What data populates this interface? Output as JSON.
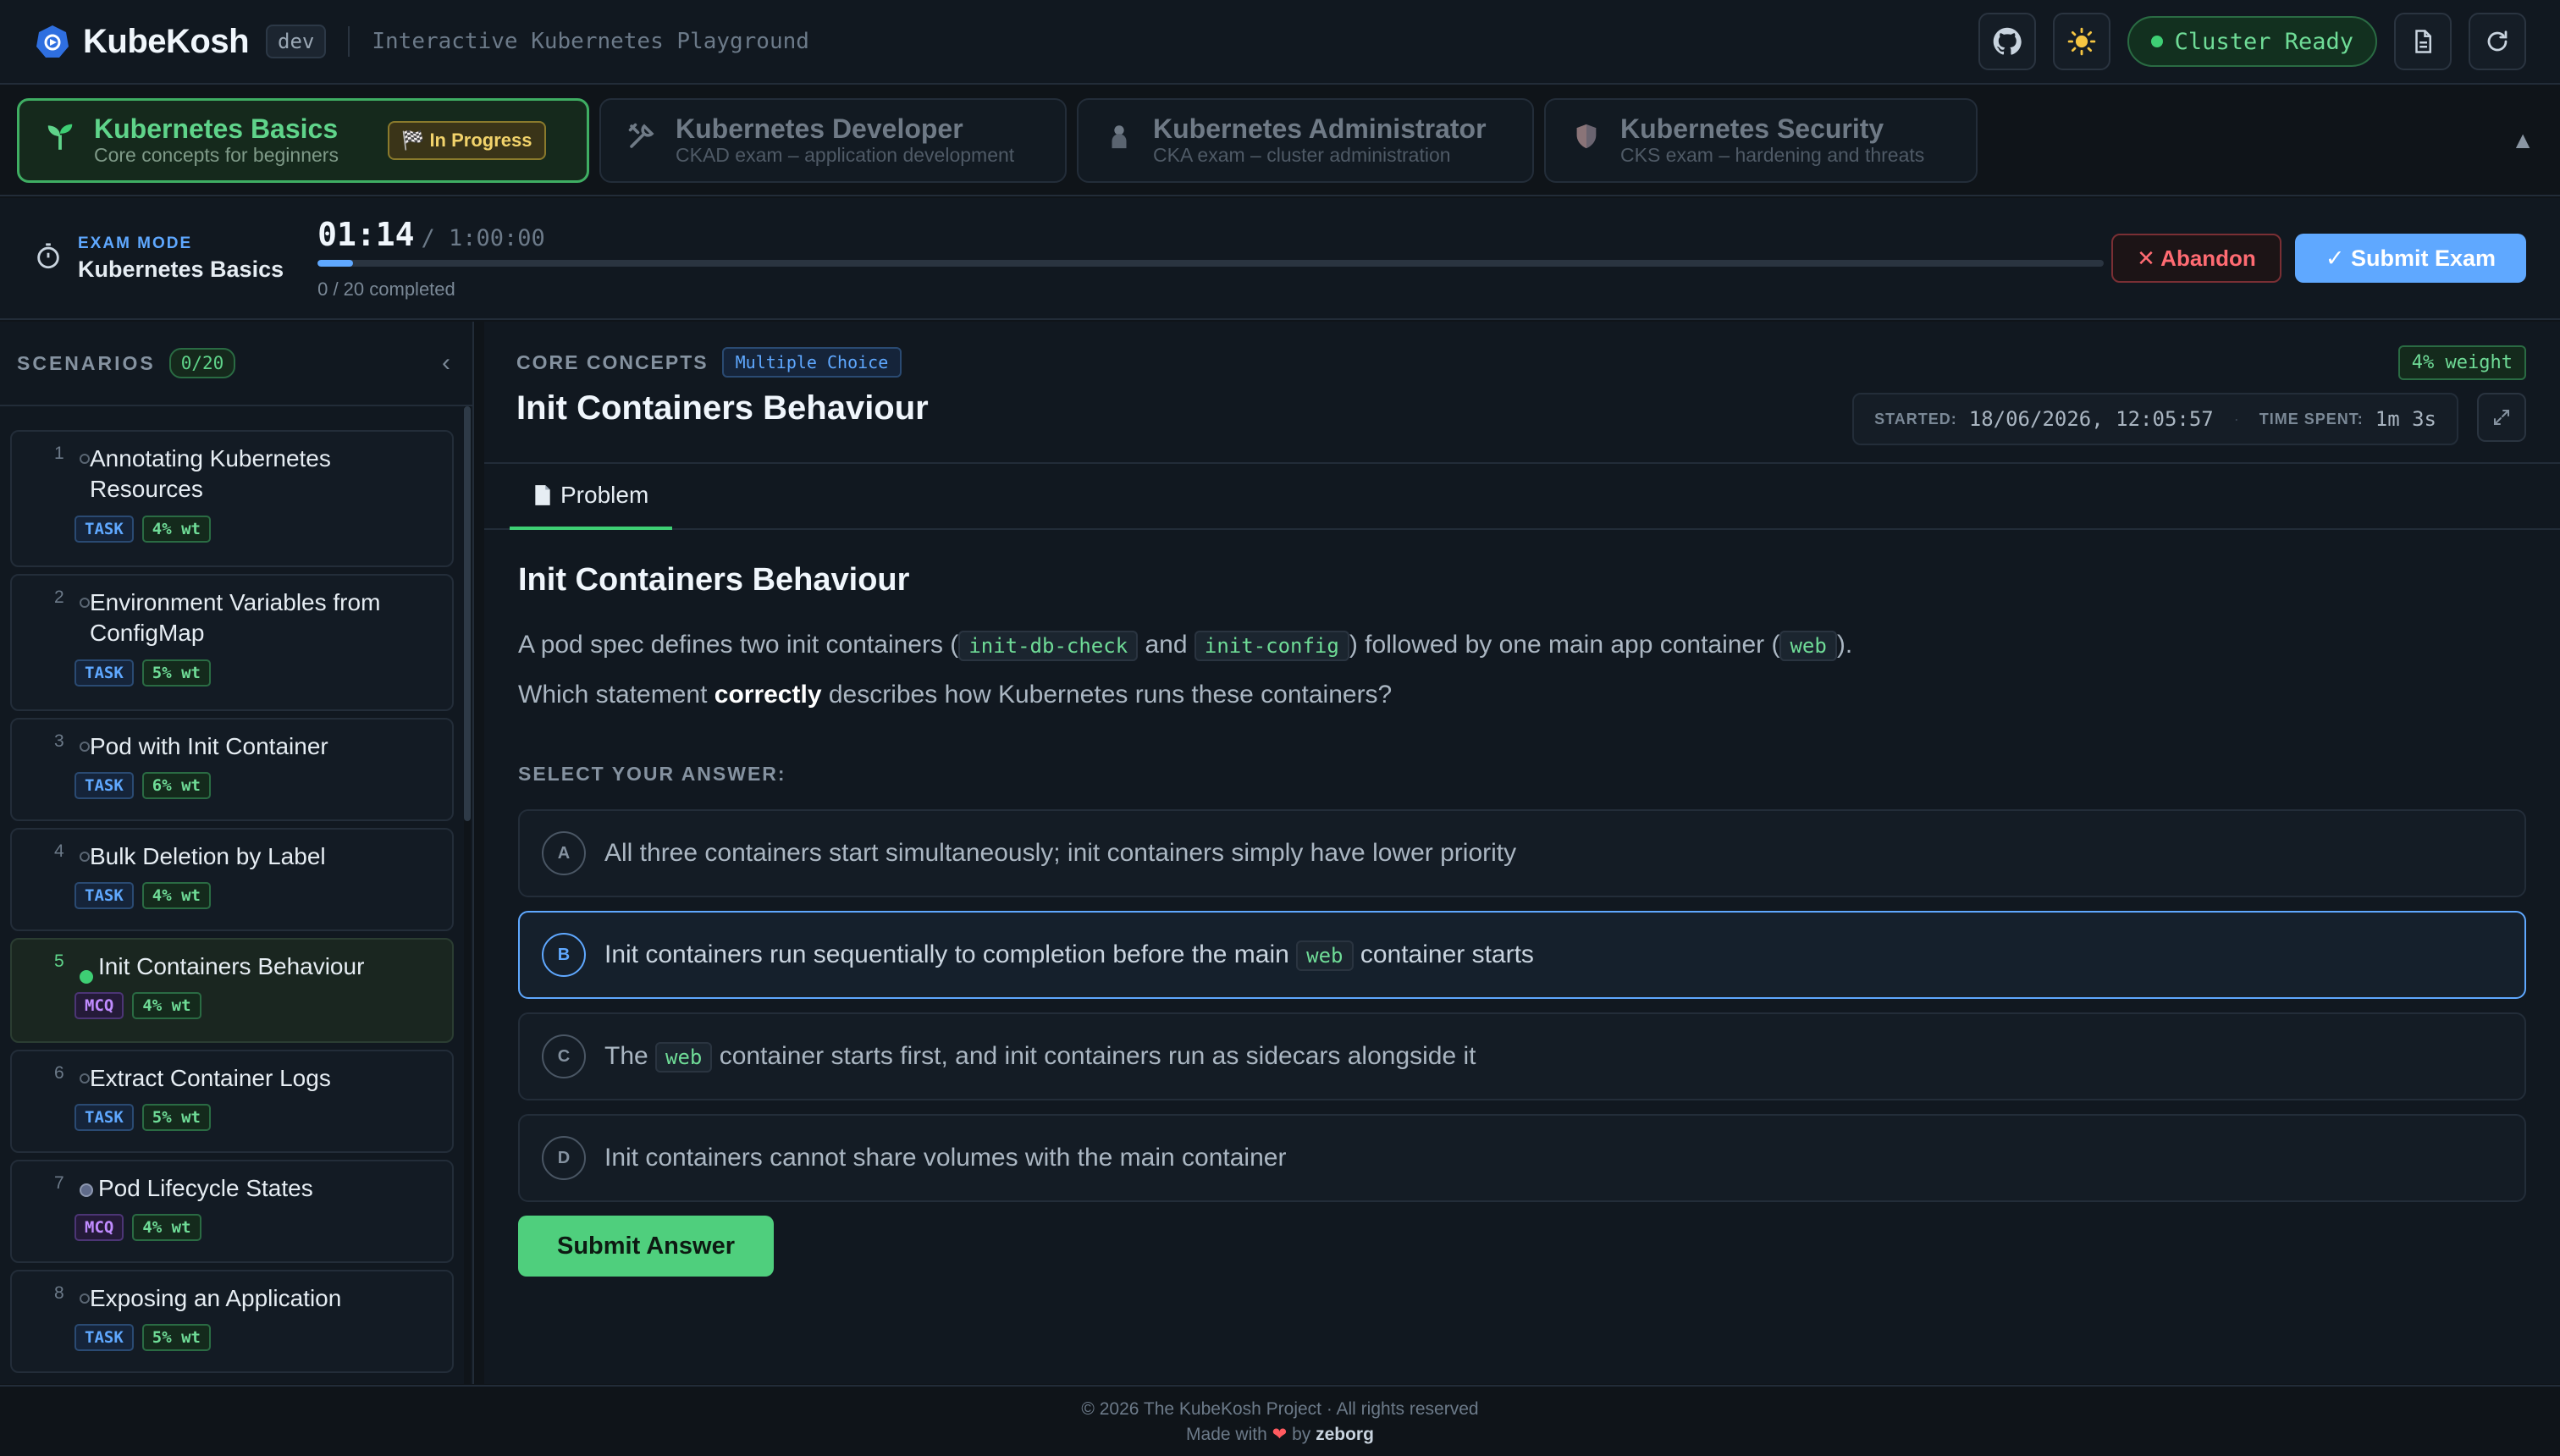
{
  "header": {
    "app_name": "KubeKosh",
    "env": "dev",
    "tagline": "Interactive Kubernetes Playground",
    "cluster_status": "Cluster Ready",
    "icons": [
      "github-icon",
      "sun-icon",
      "document-icon",
      "refresh-icon"
    ]
  },
  "tracks": [
    {
      "title": "Kubernetes Basics",
      "subtitle": "Core concepts for beginners",
      "icon": "sprout-icon",
      "badge": "🏁 In Progress",
      "active": true
    },
    {
      "title": "Kubernetes Developer",
      "subtitle": "CKAD exam – application development",
      "icon": "tools-icon"
    },
    {
      "title": "Kubernetes Administrator",
      "subtitle": "CKA exam – cluster administration",
      "icon": "admin-icon"
    },
    {
      "title": "Kubernetes Security",
      "subtitle": "CKS exam – hardening and threats",
      "icon": "shield-icon"
    }
  ],
  "exam": {
    "mode_label": "EXAM MODE",
    "mode_name": "Kubernetes Basics",
    "elapsed": "01:14",
    "total": "/ 1:00:00",
    "time_progress": 0.02,
    "completed": "0 / 20 completed",
    "abandon_label": "✕ Abandon",
    "submit_label": "✓ Submit Exam"
  },
  "sidebar": {
    "title": "SCENARIOS",
    "count": "0/20",
    "items": [
      {
        "num": "1",
        "title": "Annotating Kubernetes Resources",
        "type": "TASK",
        "weight": "4% wt"
      },
      {
        "num": "2",
        "title": "Environment Variables from ConfigMap",
        "type": "TASK",
        "weight": "5% wt"
      },
      {
        "num": "3",
        "title": "Pod with Init Container",
        "type": "TASK",
        "weight": "6% wt"
      },
      {
        "num": "4",
        "title": "Bulk Deletion by Label",
        "type": "TASK",
        "weight": "4% wt"
      },
      {
        "num": "5",
        "title": "Init Containers Behaviour",
        "type": "MCQ",
        "weight": "4% wt",
        "active": true
      },
      {
        "num": "6",
        "title": "Extract Container Logs",
        "type": "TASK",
        "weight": "5% wt"
      },
      {
        "num": "7",
        "title": "Pod Lifecycle States",
        "type": "MCQ",
        "weight": "4% wt"
      },
      {
        "num": "8",
        "title": "Exposing an Application",
        "type": "TASK",
        "weight": "5% wt"
      }
    ]
  },
  "question": {
    "category": "CORE CONCEPTS",
    "type": "Multiple Choice",
    "title": "Init Containers Behaviour",
    "weight": "4% weight",
    "started_label": "STARTED:",
    "started_value": "18/06/2026, 12:05:57",
    "time_spent_label": "TIME SPENT:",
    "time_spent_value": "1m 3s",
    "tab_label": "Problem",
    "problem_title": "Init Containers Behaviour",
    "p1_a": "A pod spec defines two init containers (",
    "p1_code1": "init-db-check",
    "p1_b": " and ",
    "p1_code2": "init-config",
    "p1_c": ") followed by one main app container (",
    "p1_code3": "web",
    "p1_d": ").",
    "p2_a": "Which statement ",
    "p2_bold": "correctly",
    "p2_b": " describes how Kubernetes runs these containers?",
    "select_label": "SELECT YOUR ANSWER:",
    "options": [
      {
        "letter": "A",
        "pre": "All three containers start simultaneously; init containers simply have lower priority"
      },
      {
        "letter": "B",
        "pre": "Init containers run sequentially to completion before the main ",
        "code": "web",
        "post": " container starts",
        "selected": true
      },
      {
        "letter": "C",
        "pre": "The ",
        "code": "web",
        "post": " container starts first, and init containers run as sidecars alongside it"
      },
      {
        "letter": "D",
        "pre": "Init containers cannot share volumes with the main container"
      }
    ],
    "submit_label": "Submit Answer"
  },
  "footer": {
    "line1": "© 2026 The KubeKosh Project · All rights reserved",
    "made_with": "Made with",
    "by": "by",
    "author": "zeborg"
  },
  "colors": {
    "accent_green": "#3ecf74",
    "accent_blue": "#5fa8ff",
    "danger": "#ff6b72",
    "background": "#0f1419"
  }
}
